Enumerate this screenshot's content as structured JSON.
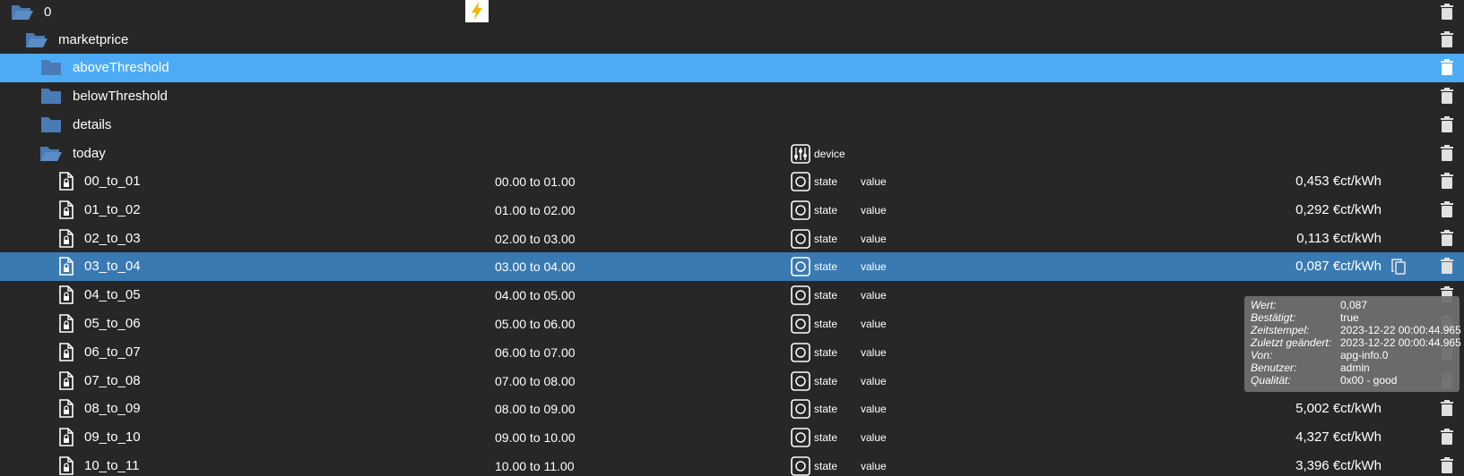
{
  "colors": {
    "background": "#272727",
    "selected_folder": "#4dabf5",
    "selected_state": "#3a7ab3",
    "folder_icon": "#4a7bb4",
    "tooltip_bg": "#6e6e6e"
  },
  "tree": {
    "root": {
      "label": "0",
      "icon": "folder-open-icon"
    },
    "marketprice": {
      "label": "marketprice",
      "icon": "folder-open-icon"
    },
    "folders": [
      {
        "label": "aboveThreshold",
        "icon": "folder-icon",
        "selected": true
      },
      {
        "label": "belowThreshold",
        "icon": "folder-icon"
      },
      {
        "label": "details",
        "icon": "folder-icon"
      }
    ],
    "today": {
      "label": "today",
      "icon": "folder-open-icon",
      "type": "device",
      "type_icon": "device-icon"
    },
    "states": [
      {
        "id": "00_to_01",
        "name": "00.00 to 01.00",
        "type": "state",
        "role": "value",
        "value": "0,453 €ct/kWh"
      },
      {
        "id": "01_to_02",
        "name": "01.00 to 02.00",
        "type": "state",
        "role": "value",
        "value": "0,292 €ct/kWh"
      },
      {
        "id": "02_to_03",
        "name": "02.00 to 03.00",
        "type": "state",
        "role": "value",
        "value": "0,113 €ct/kWh"
      },
      {
        "id": "03_to_04",
        "name": "03.00 to 04.00",
        "type": "state",
        "role": "value",
        "value": "0,087 €ct/kWh",
        "selected": true
      },
      {
        "id": "04_to_05",
        "name": "04.00 to 05.00",
        "type": "state",
        "role": "value",
        "value": ""
      },
      {
        "id": "05_to_06",
        "name": "05.00 to 06.00",
        "type": "state",
        "role": "value",
        "value": ""
      },
      {
        "id": "06_to_07",
        "name": "06.00 to 07.00",
        "type": "state",
        "role": "value",
        "value": ""
      },
      {
        "id": "07_to_08",
        "name": "07.00 to 08.00",
        "type": "state",
        "role": "value",
        "value": ""
      },
      {
        "id": "08_to_09",
        "name": "08.00 to 09.00",
        "type": "state",
        "role": "value",
        "value": "5,002 €ct/kWh"
      },
      {
        "id": "09_to_10",
        "name": "09.00 to 10.00",
        "type": "state",
        "role": "value",
        "value": "4,327 €ct/kWh"
      },
      {
        "id": "10_to_11",
        "name": "10.00 to 11.00",
        "type": "state",
        "role": "value",
        "value": "3,396 €ct/kWh"
      }
    ]
  },
  "tooltip": {
    "rows": [
      {
        "label": "Wert:",
        "value": "0,087"
      },
      {
        "label": "Bestätigt:",
        "value": "true"
      },
      {
        "label": "Zeitstempel:",
        "value": "2023-12-22 00:00:44.965"
      },
      {
        "label": "Zuletzt geändert:",
        "value": "2023-12-22 00:00:44.965"
      },
      {
        "label": "Von:",
        "value": "apg-info.0"
      },
      {
        "label": "Benutzer:",
        "value": "admin"
      },
      {
        "label": "Qualität:",
        "value": "0x00 - good"
      }
    ]
  }
}
